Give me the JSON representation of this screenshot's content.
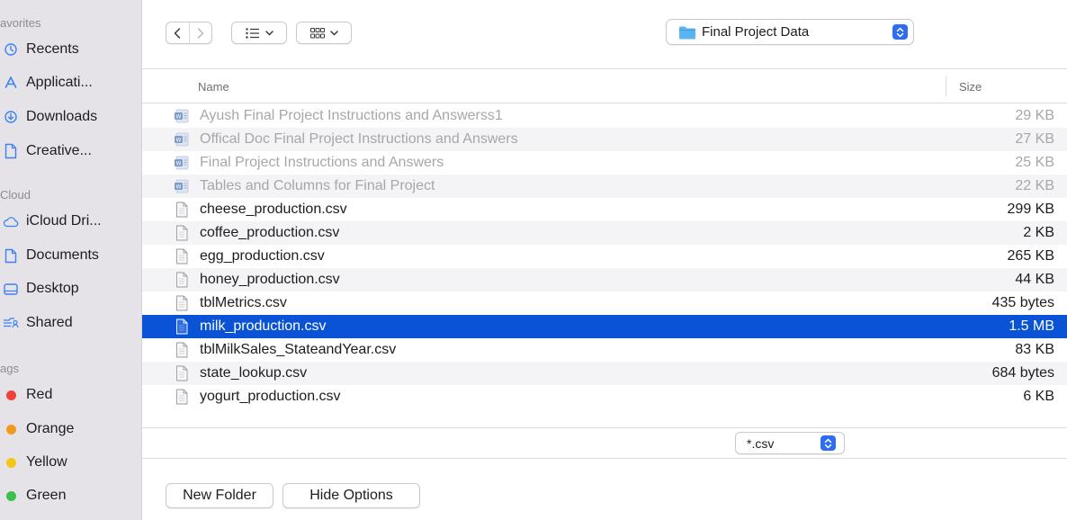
{
  "sidebar": {
    "favorites_label": "avorites",
    "favorites": [
      {
        "label": "Recents",
        "icon": "clock-icon"
      },
      {
        "label": "Applicati...",
        "icon": "applications-icon"
      },
      {
        "label": "Downloads",
        "icon": "downloads-icon"
      },
      {
        "label": "Creative...",
        "icon": "document-icon"
      }
    ],
    "cloud_label": "Cloud",
    "cloud": [
      {
        "label": "iCloud Dri...",
        "icon": "icloud-icon"
      },
      {
        "label": "Documents",
        "icon": "document-icon"
      },
      {
        "label": "Desktop",
        "icon": "desktop-icon"
      },
      {
        "label": "Shared",
        "icon": "shared-folder-icon"
      }
    ],
    "tags_label": "ags",
    "tags": [
      {
        "label": "Red",
        "color": "#f0403a"
      },
      {
        "label": "Orange",
        "color": "#f29a1f"
      },
      {
        "label": "Yellow",
        "color": "#f2c617"
      },
      {
        "label": "Green",
        "color": "#38c24b"
      }
    ]
  },
  "toolbar": {
    "location": "Final Project Data",
    "accent_color": "#2f6df0"
  },
  "list": {
    "columns": {
      "name": "Name",
      "size": "Size"
    },
    "files": [
      {
        "name": "Ayush Final Project Instructions and Answerss1",
        "size": "29 KB",
        "type": "word-doc-icon",
        "disabled": true
      },
      {
        "name": "Offical Doc Final Project Instructions and Answers",
        "size": "27 KB",
        "type": "word-doc-icon",
        "disabled": true
      },
      {
        "name": "Final Project Instructions and Answers",
        "size": "25 KB",
        "type": "word-doc-icon",
        "disabled": true
      },
      {
        "name": "Tables and Columns for Final Project",
        "size": "22 KB",
        "type": "word-doc-icon",
        "disabled": true
      },
      {
        "name": "cheese_production.csv",
        "size": "299 KB",
        "type": "csv-file-icon",
        "disabled": false
      },
      {
        "name": "coffee_production.csv",
        "size": "2 KB",
        "type": "csv-file-icon",
        "disabled": false
      },
      {
        "name": "egg_production.csv",
        "size": "265 KB",
        "type": "csv-file-icon",
        "disabled": false
      },
      {
        "name": "honey_production.csv",
        "size": "44 KB",
        "type": "csv-file-icon",
        "disabled": false
      },
      {
        "name": "tblMetrics.csv",
        "size": "435 bytes",
        "type": "csv-file-icon",
        "disabled": false
      },
      {
        "name": "milk_production.csv",
        "size": "1.5 MB",
        "type": "csv-file-icon",
        "disabled": false,
        "selected": true
      },
      {
        "name": "tblMilkSales_StateandYear.csv",
        "size": "83 KB",
        "type": "csv-file-icon",
        "disabled": false
      },
      {
        "name": "state_lookup.csv",
        "size": "684 bytes",
        "type": "csv-file-icon",
        "disabled": false
      },
      {
        "name": "yogurt_production.csv",
        "size": "6 KB",
        "type": "csv-file-icon",
        "disabled": false
      }
    ],
    "selected_color": "#0a53d6"
  },
  "filter": {
    "value": "*.csv"
  },
  "buttons": {
    "new_folder": "New Folder",
    "hide_options": "Hide Options"
  }
}
